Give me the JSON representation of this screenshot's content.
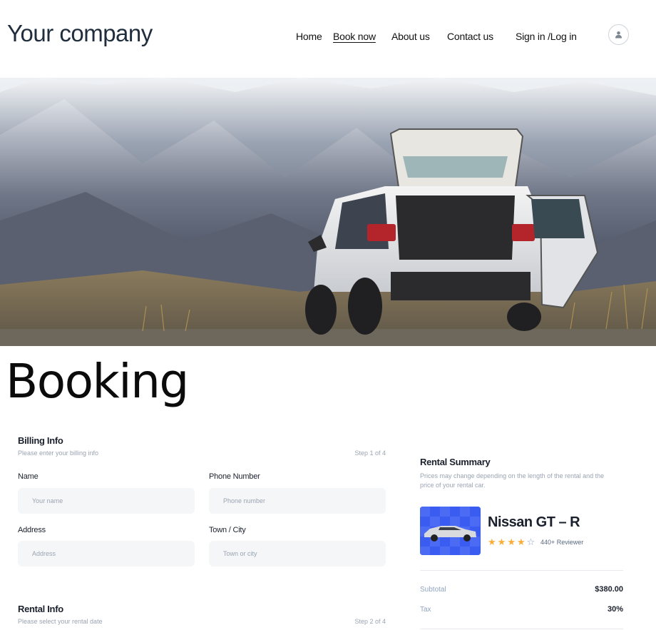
{
  "header": {
    "logo": "Your company",
    "nav": {
      "home": "Home",
      "book_now": "Book now",
      "about_us": "About us",
      "contact_us": "Contact us",
      "sign_in": "Sign in /Log in"
    },
    "avatar_icon": "user-icon"
  },
  "hero": {
    "image": "car-mountain-hero"
  },
  "page_title": "Booking",
  "billing": {
    "title": "Billing Info",
    "subtitle": "Please enter your billing info",
    "step": "Step 1 of 4",
    "name_label": "Name",
    "name_placeholder": "Your name",
    "phone_label": "Phone Number",
    "phone_placeholder": "Phone number",
    "address_label": "Address",
    "address_placeholder": "Address",
    "city_label": "Town / City",
    "city_placeholder": "Town or city"
  },
  "rental": {
    "title": "Rental Info",
    "subtitle": "Please select your rental date",
    "step": "Step 2 of 4"
  },
  "summary": {
    "title": "Rental Summary",
    "description": "Prices may change depending on the length of the rental and the price of your rental car.",
    "car_name": "Nissan GT – R",
    "rating": 4,
    "rating_max": 5,
    "reviews": "440+ Reviewer",
    "subtotal_label": "Subtotal",
    "subtotal_value": "$380.00",
    "tax_label": "Tax",
    "tax_value": "30%"
  },
  "colors": {
    "star": "#fbad39",
    "car_card": "#3a5cf0"
  }
}
